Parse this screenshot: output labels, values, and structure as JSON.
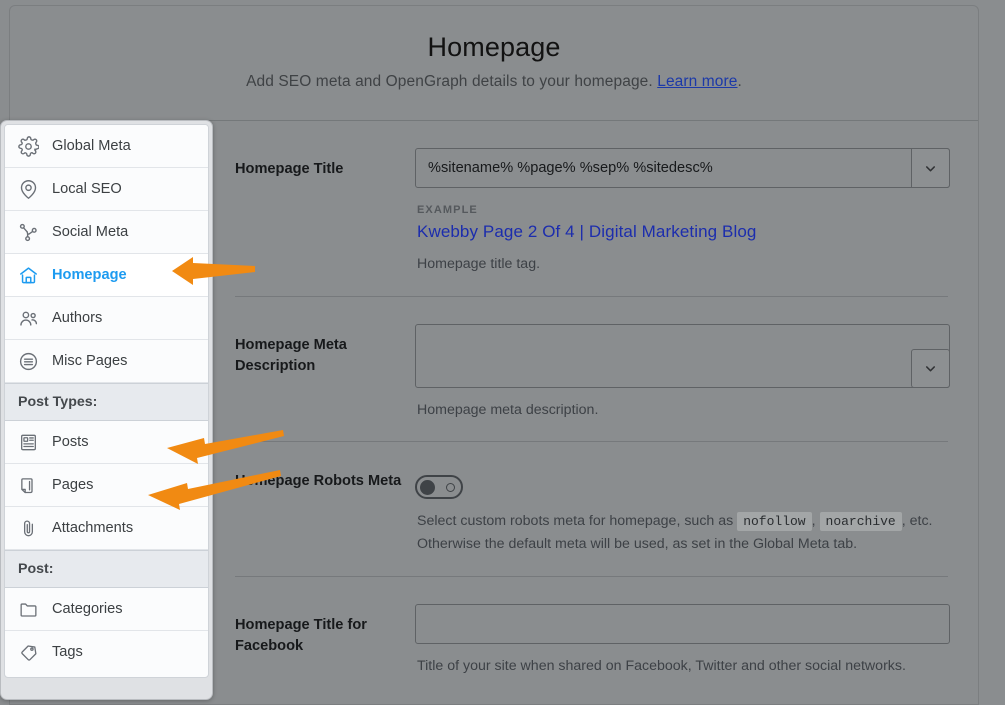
{
  "header": {
    "title": "Homepage",
    "subtitle_before": "Add SEO meta and OpenGraph details to your homepage.",
    "link_label": "Learn more",
    "subtitle_after": "."
  },
  "sidebar": {
    "items": [
      {
        "label": "Global Meta",
        "icon": "gear-icon",
        "active": false
      },
      {
        "label": "Local SEO",
        "icon": "map-pin-icon",
        "active": false
      },
      {
        "label": "Social Meta",
        "icon": "share-nodes-icon",
        "active": false
      },
      {
        "label": "Homepage",
        "icon": "home-icon",
        "active": true
      },
      {
        "label": "Authors",
        "icon": "users-icon",
        "active": false
      },
      {
        "label": "Misc Pages",
        "icon": "list-circle-icon",
        "active": false
      }
    ],
    "section_post_types": "Post Types:",
    "post_type_items": [
      {
        "label": "Posts",
        "icon": "newspaper-icon"
      },
      {
        "label": "Pages",
        "icon": "page-icon"
      },
      {
        "label": "Attachments",
        "icon": "paperclip-icon"
      }
    ],
    "section_post": "Post:",
    "post_items": [
      {
        "label": "Categories",
        "icon": "folder-icon"
      },
      {
        "label": "Tags",
        "icon": "tag-icon"
      }
    ]
  },
  "fields": {
    "homepage_title": {
      "label": "Homepage Title",
      "value": "%sitename% %page% %sep% %sitedesc%",
      "placeholder": "",
      "example_label": "EXAMPLE",
      "example_value": "Kwebby Page 2 Of 4 | Digital Marketing Blog",
      "help": "Homepage title tag.",
      "chevron": "chevron-down-icon"
    },
    "homepage_meta_description": {
      "label": "Homepage Meta Description",
      "value": "",
      "placeholder": "",
      "help": "Homepage meta description.",
      "chevron": "chevron-down-icon"
    },
    "homepage_robots_meta": {
      "label": "Homepage Robots Meta",
      "toggle_state": "off",
      "help_part1": "Select custom robots meta for homepage, such as",
      "code1": "nofollow",
      "help_part2": ",",
      "code2": "noarchive",
      "help_part3": ", etc. Otherwise the default meta will be used, as set in the Global Meta tab."
    },
    "homepage_title_facebook": {
      "label": "Homepage Title for Facebook",
      "value": "",
      "placeholder": "",
      "help": "Title of your site when shared on Facebook, Twitter and other social networks."
    }
  },
  "colors": {
    "accent_active": "#1d9bf0",
    "active_bar": "#1b4f72",
    "annotation_arrow": "#f18a12",
    "example_text": "#1c2dad",
    "link": "#1c39a8"
  },
  "annotations": [
    {
      "name": "arrow-to-homepage",
      "target": "Homepage"
    },
    {
      "name": "arrow-to-posts",
      "target": "Posts"
    },
    {
      "name": "arrow-to-pages",
      "target": "Pages"
    }
  ]
}
